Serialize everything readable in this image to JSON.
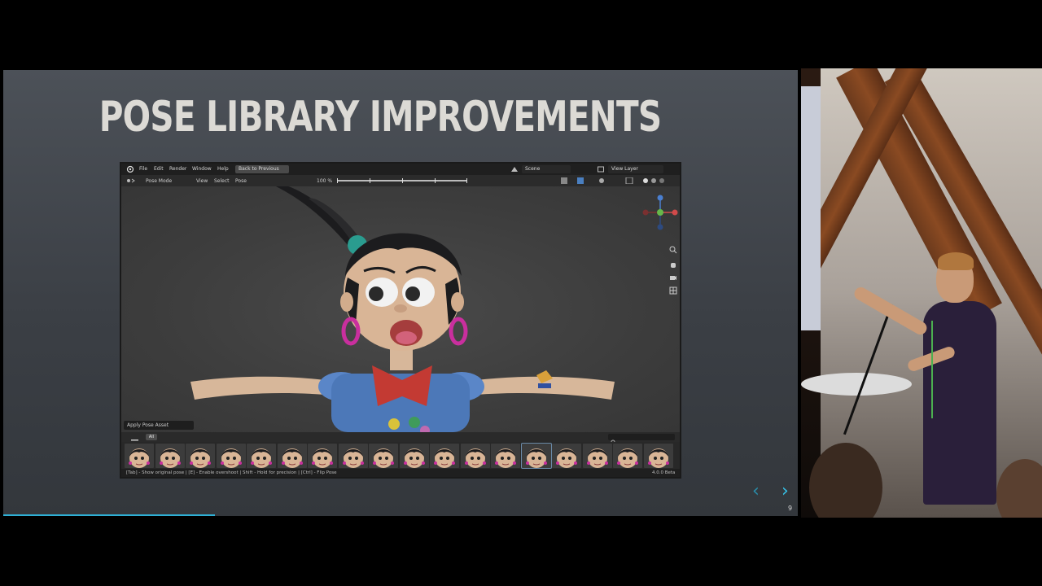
{
  "slide": {
    "title": "POSE LIBRARY IMPROVEMENTS",
    "nav_prev": "‹",
    "nav_next": "›",
    "slide_number": "9"
  },
  "blender": {
    "menu": [
      "File",
      "Edit",
      "Render",
      "Window",
      "Help"
    ],
    "back_to_previous": "Back to Previous",
    "scene": "Scene",
    "view_layer": "View Layer",
    "mode": "Pose Mode",
    "header_menus": [
      "View",
      "Select",
      "Pose"
    ],
    "zoom": "100 %",
    "apply_pose_asset": "Apply Pose Asset",
    "asset_filter": "All",
    "status_hint": "[Tab] - Show original pose | [E] - Enable overshoot | Shift - Hold for precision | [Ctrl] - Flip Pose",
    "version": "4.0.0 Beta",
    "thumbnail_count": 18,
    "colors": {
      "accent": "#36c0e6",
      "viewport_bg": "#404040",
      "header_bg": "#1f1f1f"
    },
    "icons": [
      "blender-logo-icon",
      "pose-mode-icon",
      "scene-icon",
      "view-layer-icon",
      "gizmo-axes-icon",
      "zoom-icon",
      "hand-pan-icon",
      "camera-icon",
      "grid-icon",
      "menu-hamburger-icon",
      "search-icon"
    ]
  }
}
